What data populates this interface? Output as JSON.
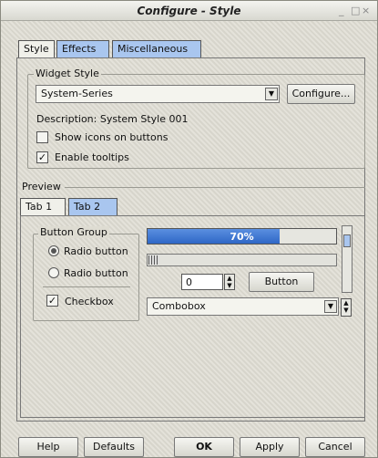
{
  "window": {
    "title": "Configure - Style",
    "controls": [
      "_",
      "□",
      "×"
    ]
  },
  "tabs": [
    {
      "label": "Style",
      "active": true
    },
    {
      "label": "Effects",
      "active": false
    },
    {
      "label": "Miscellaneous",
      "active": false
    }
  ],
  "widget_style": {
    "legend": "Widget Style",
    "selected_style": "System-Series",
    "configure_label": "Configure...",
    "description": "Description: System Style 001",
    "show_icons_label": "Show icons on buttons",
    "show_icons_checked": false,
    "tooltips_label": "Enable tooltips",
    "tooltips_checked": true
  },
  "preview": {
    "legend": "Preview",
    "tabs": [
      {
        "label": "Tab 1",
        "active": true
      },
      {
        "label": "Tab 2",
        "active": false
      }
    ],
    "button_group_legend": "Button Group",
    "radio1_label": "Radio button",
    "radio2_label": "Radio button",
    "checkbox_label": "Checkbox",
    "progress_value": 0.7,
    "progress_text": "70%",
    "spin_value": "0",
    "button_label": "Button",
    "combobox_value": "Combobox"
  },
  "footer": {
    "help_label": "Help",
    "defaults_label": "Defaults",
    "ok_label": "OK",
    "apply_label": "Apply",
    "cancel_label": "Cancel"
  },
  "colors": {
    "accent": "#a9c6ef",
    "progress": "#2f67c6",
    "background": "#dedcd2"
  }
}
